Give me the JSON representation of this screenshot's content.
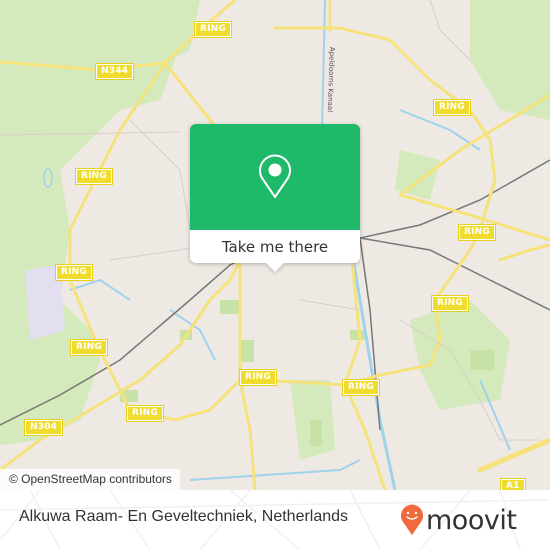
{
  "map": {
    "road_labels": [
      {
        "id": "n344",
        "text": "N344"
      },
      {
        "id": "ring-nw",
        "text": "RING"
      },
      {
        "id": "ring-w1",
        "text": "RING"
      },
      {
        "id": "ring-w2",
        "text": "RING"
      },
      {
        "id": "ring-w3",
        "text": "RING"
      },
      {
        "id": "ring-sw",
        "text": "RING"
      },
      {
        "id": "n304",
        "text": "N304"
      },
      {
        "id": "ring-s1",
        "text": "RING"
      },
      {
        "id": "ring-s2",
        "text": "RING"
      },
      {
        "id": "ring-ne",
        "text": "RING"
      },
      {
        "id": "ring-e1",
        "text": "RING"
      },
      {
        "id": "ring-e2",
        "text": "RING"
      },
      {
        "id": "a1",
        "text": "A1"
      }
    ],
    "canal_label": "Apeldoorns Kanaal",
    "attribution": "© OpenStreetMap contributors",
    "colors": {
      "land": "#efe9e4",
      "park": "#cde7b0",
      "water": "#9fd3ec",
      "road_major": "#f6e27a",
      "rail": "#777777"
    }
  },
  "popup": {
    "icon": "map-pin-icon",
    "button_label": "Take me there",
    "accent_color": "#1fba69"
  },
  "footer": {
    "place_name": "Alkuwa Raam- En Geveltechniek, Netherlands",
    "brand": "moovit",
    "brand_color": "#f06a3c"
  }
}
